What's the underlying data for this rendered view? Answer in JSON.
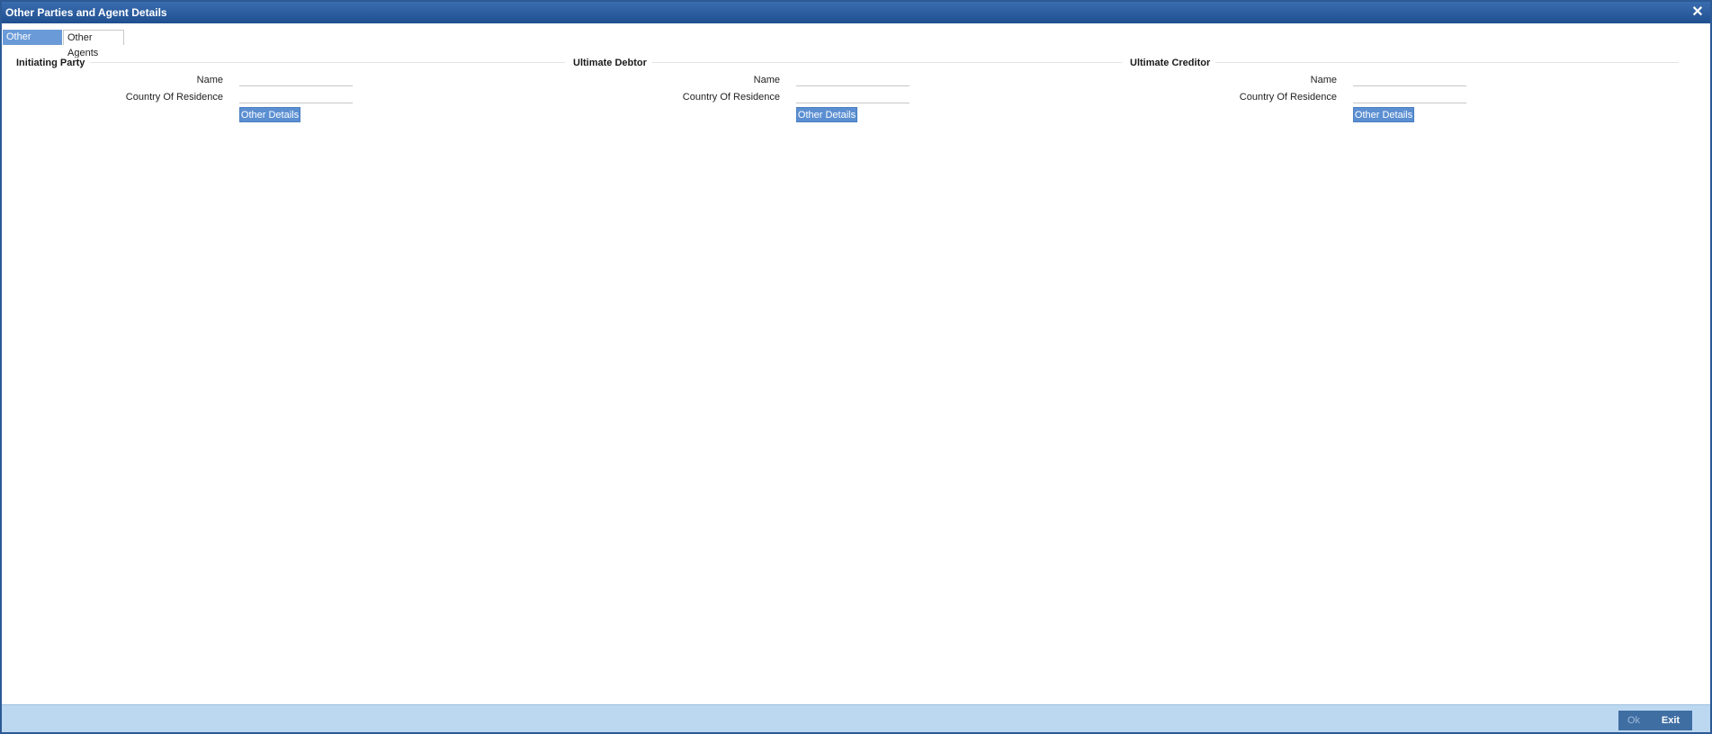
{
  "window": {
    "title": "Other Parties and Agent Details",
    "close_glyph": "✕"
  },
  "tabs": [
    {
      "label": "Other Parties",
      "active": true
    },
    {
      "label": "Other Agents",
      "active": false
    }
  ],
  "sections": [
    {
      "heading": "Initiating Party",
      "name_label": "Name",
      "name_value": "",
      "country_label": "Country Of Residence",
      "country_value": "",
      "button_label": "Other Details"
    },
    {
      "heading": "Ultimate Debtor",
      "name_label": "Name",
      "name_value": "",
      "country_label": "Country Of Residence",
      "country_value": "",
      "button_label": "Other Details"
    },
    {
      "heading": "Ultimate Creditor",
      "name_label": "Name",
      "name_value": "",
      "country_label": "Country Of Residence",
      "country_value": "",
      "button_label": "Other Details"
    }
  ],
  "footer": {
    "ok_label": "Ok",
    "exit_label": "Exit"
  },
  "colors": {
    "title_bar": "#2a5d9f",
    "active_tab": "#6a9bd8",
    "button": "#5b8fd2",
    "footer_bar": "#bcd8f0",
    "footer_button": "#3f6ea3"
  }
}
